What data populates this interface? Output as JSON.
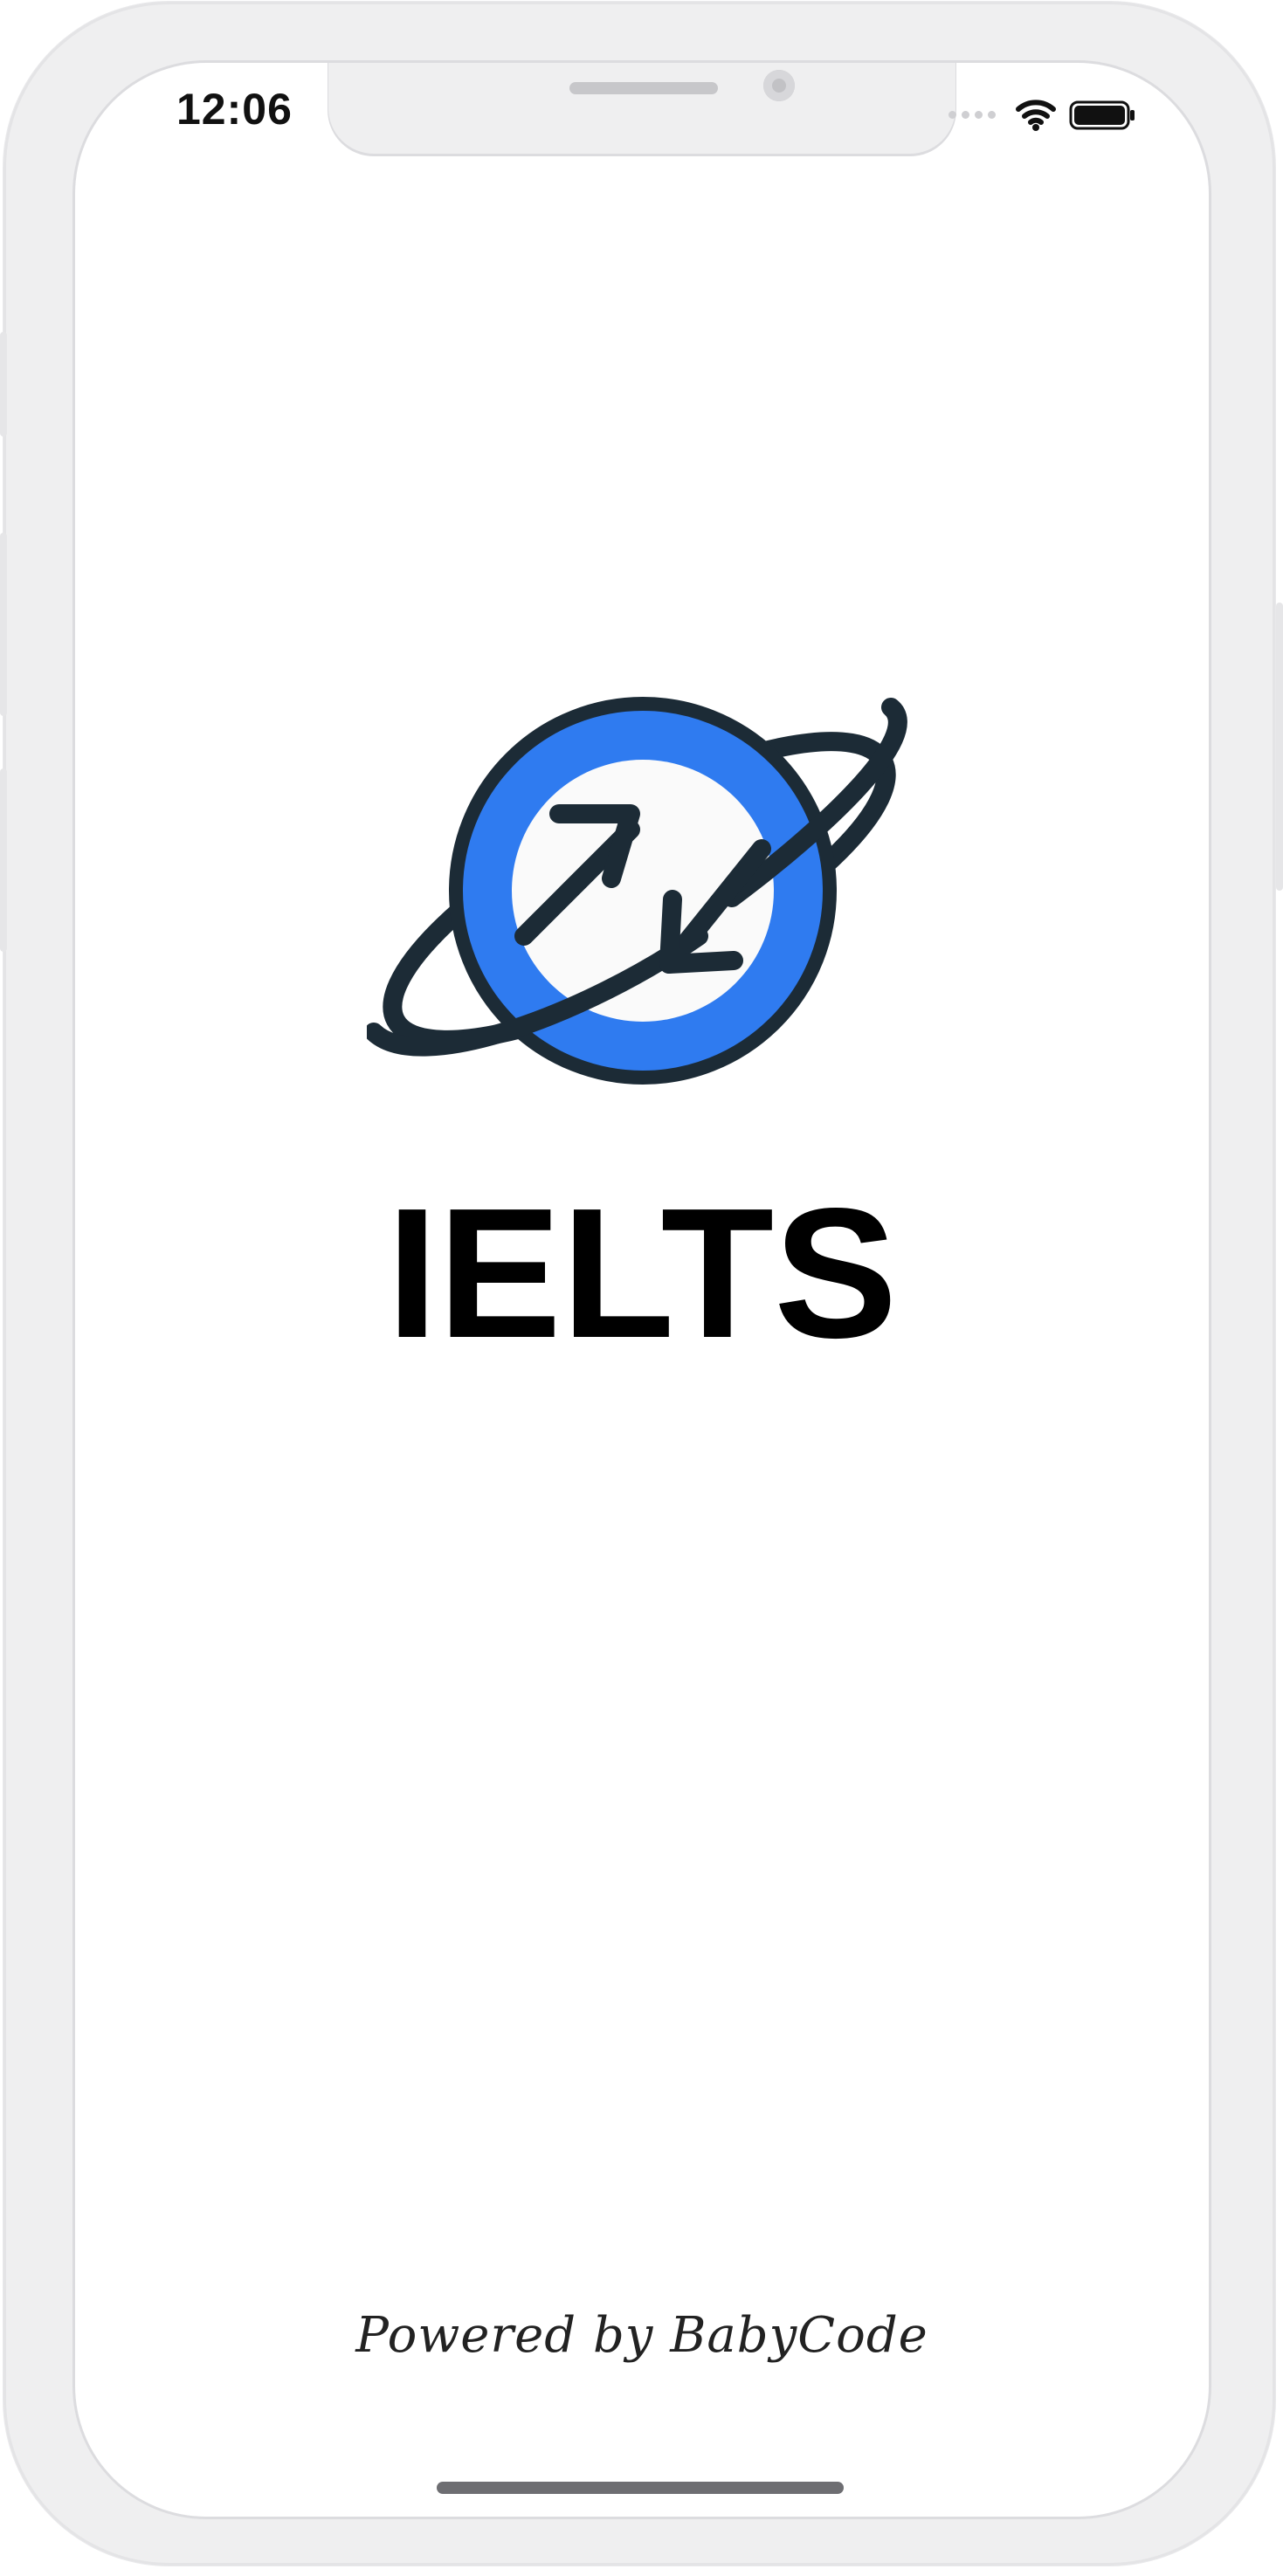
{
  "status_bar": {
    "time": "12:06",
    "icons": [
      "signal-dots-icon",
      "wifi-icon",
      "battery-icon"
    ]
  },
  "splash": {
    "logo_icon": "planet-sync-logo",
    "title": "IELTS",
    "footer": "Powered by BabyCode"
  },
  "colors": {
    "accent": "#2f7bf0",
    "outline": "#1c2b36",
    "title": "#000000"
  }
}
